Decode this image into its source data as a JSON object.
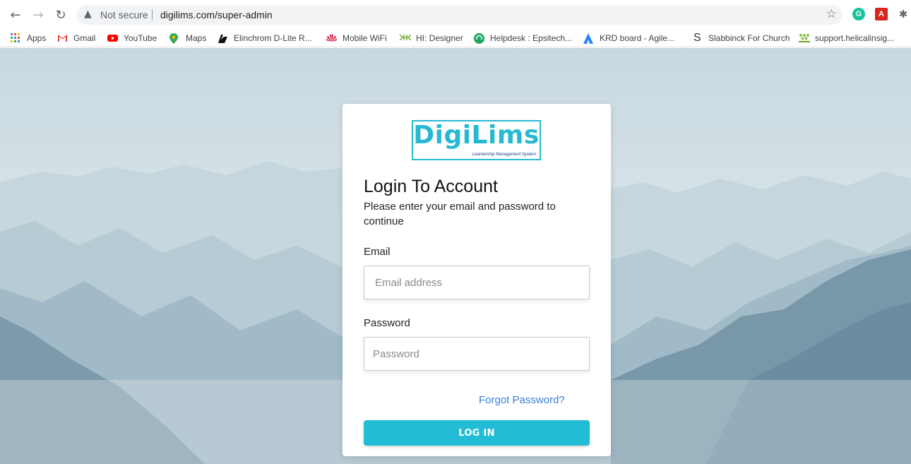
{
  "browser": {
    "security_label": "Not secure",
    "url": "digilims.com/super-admin",
    "bookmarks": [
      {
        "label": "Apps",
        "icon": "apps-grid-icon"
      },
      {
        "label": "Gmail",
        "icon": "gmail-icon"
      },
      {
        "label": "YouTube",
        "icon": "youtube-icon"
      },
      {
        "label": "Maps",
        "icon": "maps-pin-icon"
      },
      {
        "label": "Elinchrom D-Lite R...",
        "icon": "elinchrom-icon"
      },
      {
        "label": "Mobile WiFi",
        "icon": "huawei-icon"
      },
      {
        "label": "HI: Designer",
        "icon": "hi-designer-icon"
      },
      {
        "label": "Helpdesk : Epsitech...",
        "icon": "helpdesk-icon"
      },
      {
        "label": "KRD board - Agile...",
        "icon": "jira-icon"
      },
      {
        "label": "Slabbinck For Church",
        "icon": "slabbinck-icon"
      },
      {
        "label": "support.helicalinsig...",
        "icon": "helical-icon"
      }
    ],
    "extensions": [
      {
        "name": "grammarly-icon",
        "glyph": "G",
        "color": "#15c39a"
      },
      {
        "name": "acrobat-icon",
        "glyph": "A",
        "color": "#d7261d"
      },
      {
        "name": "extensions-puzzle-icon",
        "glyph": "✱",
        "color": "#5f6368"
      }
    ]
  },
  "login": {
    "logo_text": "DigiLims",
    "logo_subtitle": "Learnership Management System",
    "title": "Login To Account",
    "subtitle": "Please enter your email and password to continue",
    "email_label": "Email",
    "email_placeholder": "Email address",
    "email_value": "",
    "password_label": "Password",
    "password_placeholder": "Password",
    "password_value": "",
    "forgot_link": "Forgot Password?",
    "login_button": "LOG IN"
  },
  "colors": {
    "accent": "#22bcd6",
    "link": "#3b7dd8",
    "logo": "#27b9d3"
  }
}
